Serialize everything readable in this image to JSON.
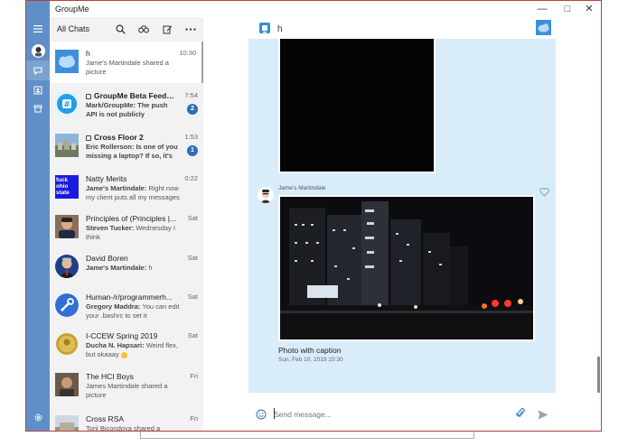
{
  "window": {
    "title": "GroupMe"
  },
  "chat_list": {
    "header_title": "All Chats",
    "chats": [
      {
        "name": "h",
        "sender": "",
        "preview": "Jame's Martindale shared a picture",
        "time": "10:30",
        "badge": "",
        "locked": false,
        "bold": false
      },
      {
        "name": "GroupMe Beta Feedb...",
        "sender": "Mark/GroupMe:",
        "preview": "The push API is not publicly documented. Sorry",
        "time": "7:54",
        "badge": "2",
        "locked": true,
        "bold": true
      },
      {
        "name": "Cross Floor 2",
        "sender": "Eric Rollerson:",
        "preview": "Is one of you missing a laptop? If so, it's in the...",
        "time": "1:53",
        "badge": "1",
        "locked": true,
        "bold": true
      },
      {
        "name": "Natty Merits",
        "sender": "Jame's Martindale:",
        "preview": "Right now my client puts all my messages in on...",
        "time": "0:22",
        "badge": "",
        "locked": false,
        "bold": false
      },
      {
        "name": "Principles of (Principles |...",
        "sender": "Steven Tucker:",
        "preview": "Wednesday I think",
        "time": "Sat",
        "badge": "",
        "locked": false,
        "bold": false
      },
      {
        "name": "David Boren",
        "sender": "Jame's Martindale:",
        "preview": "h",
        "time": "Sat",
        "badge": "",
        "locked": false,
        "bold": false
      },
      {
        "name": "Human-/r/programmerh...",
        "sender": "Gregory Maddra:",
        "preview": "You can edit your .bashrc to set it permanentl...",
        "time": "Sat",
        "badge": "",
        "locked": false,
        "bold": false
      },
      {
        "name": "I-CCEW Spring 2019",
        "sender": "Ducha N. Hapsari:",
        "preview": "Weird flex, but okaaay",
        "time": "Sat",
        "badge": "",
        "locked": false,
        "bold": false
      },
      {
        "name": "The HCI Boys",
        "sender": "",
        "preview": "James Martindale shared a picture",
        "time": "Fri",
        "badge": "",
        "locked": false,
        "bold": false
      },
      {
        "name": "Cross RSA",
        "sender": "",
        "preview": "Torii Bicondova shared a picture",
        "time": "Fri",
        "badge": "",
        "locked": false,
        "bold": false
      }
    ],
    "avatar_text_natty": "fuck ohio state"
  },
  "conversation": {
    "title": "h",
    "message": {
      "sender": "Jame's Martindale",
      "caption": "Photo with caption",
      "timestamp": "Sun, Feb 10, 2019 10:30"
    },
    "composer_placeholder": "Send message..."
  },
  "colors": {
    "rail": "#5f8fc6",
    "conversation_bg": "#d8ecfa",
    "badge": "#2d6fb7",
    "accent": "#2d6fb7"
  }
}
